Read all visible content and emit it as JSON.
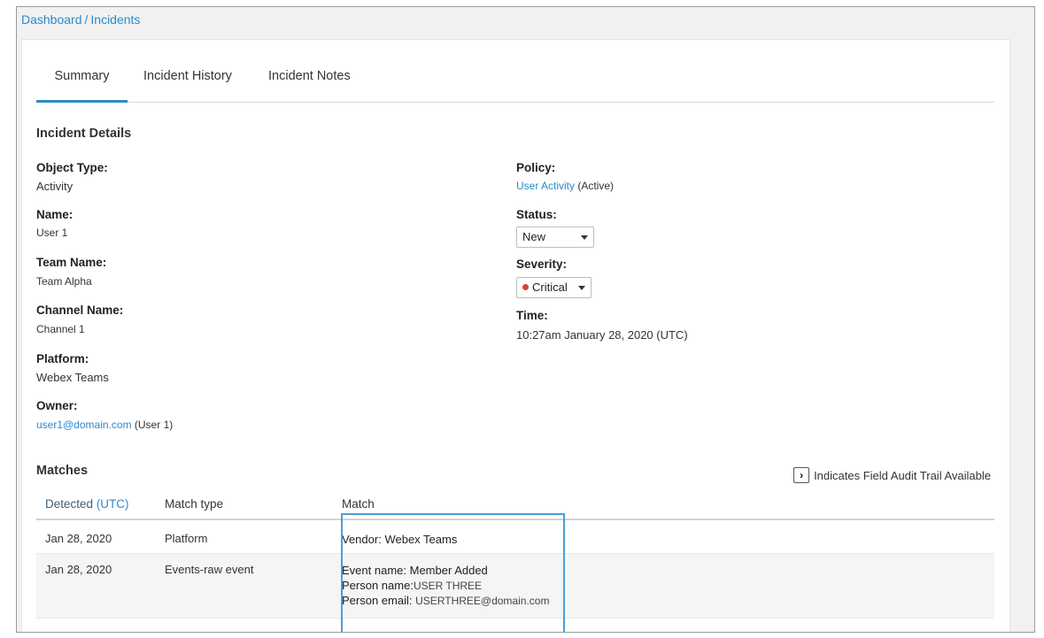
{
  "breadcrumb": {
    "dashboard": "Dashboard",
    "separator": "/",
    "current": "Incidents"
  },
  "tabs": [
    {
      "label": "Summary",
      "active": true
    },
    {
      "label": "Incident History",
      "active": false
    },
    {
      "label": "Incident Notes",
      "active": false
    }
  ],
  "details": {
    "title": "Incident Details",
    "object_type": {
      "label": "Object Type:",
      "value": "Activity"
    },
    "name": {
      "label": "Name:",
      "value": "User 1"
    },
    "team_name": {
      "label": "Team Name:",
      "value": "Team Alpha"
    },
    "channel_name": {
      "label": "Channel Name:",
      "value": "Channel 1"
    },
    "platform": {
      "label": "Platform:",
      "value": "Webex Teams"
    },
    "owner": {
      "label": "Owner:",
      "email": "user1@domain.com",
      "suffix": " (User 1)"
    },
    "policy": {
      "label": "Policy:",
      "link": "User Activity",
      "suffix": " (Active)"
    },
    "status": {
      "label": "Status:",
      "selected": "New"
    },
    "severity": {
      "label": "Severity:",
      "selected": "Critical",
      "color": "#d9403a"
    },
    "time": {
      "label": "Time:",
      "value": "10:27am January 28, 2020 (UTC)"
    }
  },
  "matches": {
    "title": "Matches",
    "legend_text": "Indicates Field Audit Trail Available",
    "columns": {
      "detected": "Detected",
      "detected_unit": "(UTC)",
      "match_type": "Match type",
      "match": "Match"
    },
    "rows": [
      {
        "detected": "Jan 28, 2020",
        "match_type": "Platform",
        "lines": [
          {
            "key": "Vendor:",
            "value": "Webex Teams"
          }
        ]
      },
      {
        "detected": "Jan 28, 2020",
        "match_type": "Events-raw event",
        "lines": [
          {
            "key": "Event name:",
            "value": "Member Added"
          },
          {
            "key": "Person name:",
            "value": "USER THREE"
          },
          {
            "key": "Person email:",
            "value": "USERTHREE@domain.com"
          }
        ]
      }
    ]
  },
  "colors": {
    "accent": "#2c8ac9",
    "highlight_border": "#4a9fd5"
  }
}
